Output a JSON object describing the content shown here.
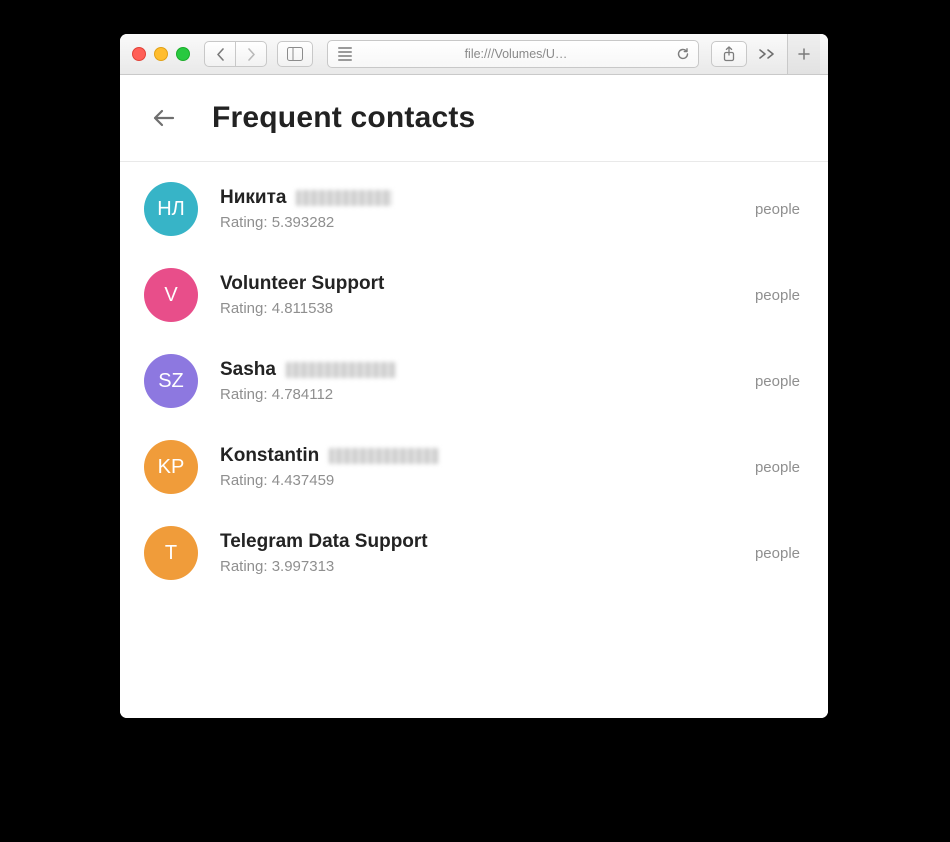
{
  "browser": {
    "url": "file:///Volumes/U…"
  },
  "page": {
    "title": "Frequent contacts",
    "rating_label": "Rating: "
  },
  "contacts": [
    {
      "initials": "НЛ",
      "color": "#37b4c7",
      "name_visible": "Никита",
      "name_redacted": true,
      "redact_width": 96,
      "rating": "5.393282",
      "tag": "people"
    },
    {
      "initials": "V",
      "color": "#e84e8a",
      "name_visible": "Volunteer Support",
      "name_redacted": false,
      "redact_width": 0,
      "rating": "4.811538",
      "tag": "people"
    },
    {
      "initials": "SZ",
      "color": "#8d78e0",
      "name_visible": "Sasha",
      "name_redacted": true,
      "redact_width": 110,
      "rating": "4.784112",
      "tag": "people"
    },
    {
      "initials": "KP",
      "color": "#f09c3a",
      "name_visible": "Konstantin",
      "name_redacted": true,
      "redact_width": 110,
      "rating": "4.437459",
      "tag": "people"
    },
    {
      "initials": "T",
      "color": "#f09c3a",
      "name_visible": "Telegram Data Support",
      "name_redacted": false,
      "redact_width": 0,
      "rating": "3.997313",
      "tag": "people"
    }
  ]
}
